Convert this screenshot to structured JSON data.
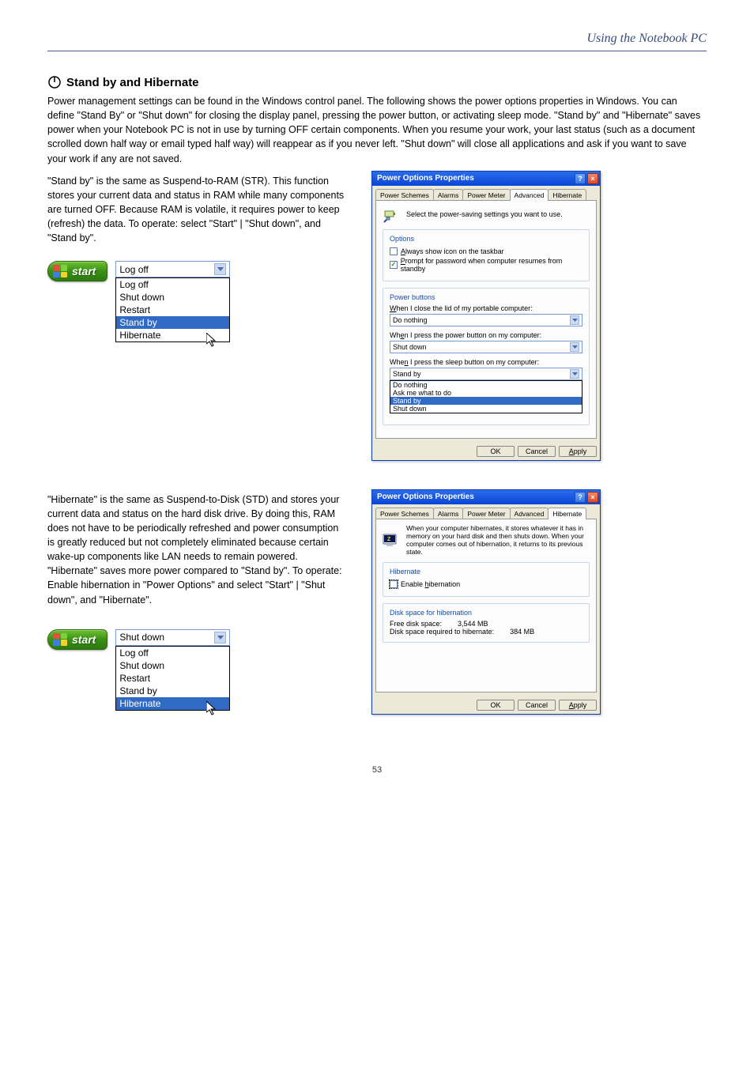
{
  "header": {
    "title": "Using the Notebook PC"
  },
  "section1": {
    "title": "Stand by and Hibernate",
    "body1": "Power management settings can be found in the Windows control panel. The following shows the power options properties in Windows. You can define \"Stand By\" or \"Shut down\" for closing the display panel, pressing the power button, or activating sleep mode. \"Stand by\" and \"Hibernate\" saves power when your Notebook PC is not in use by turning OFF certain components. When you resume your work, your last status (such as a document scrolled down half way or email typed half way) will reappear as if you never left. \"Shut down\" will close all applications and ask if you want to save your work if any are not saved.",
    "body2": "\"Stand by\" is the same as Suspend-to-RAM (STR). This function stores your current data and status in RAM while many components are turned OFF. Because RAM is volatile, it requires power to keep (refresh) the data. To operate: select \"Start\" | \"Shut down\", and \"Stand by\".",
    "body3": "\"Hibernate\" is the same as Suspend-to-Disk (STD) and stores your current data and status on the hard disk drive. By doing this, RAM does not have to be periodically refreshed and power consumption is greatly reduced but not completely eliminated because certain wake-up components like LAN needs to remain powered. \"Hibernate\" saves more power compared to \"Stand by\". To operate: Enable hibernation in \"Power Options\" and select \"Start\" | \"Shut down\", and \"Hibernate\"."
  },
  "startButton": {
    "label": "start"
  },
  "standbyMenu": {
    "selected": "Log off",
    "items": [
      "Log off",
      "Shut down",
      "Restart",
      "Stand by",
      "Hibernate"
    ],
    "highlighted": "Stand by"
  },
  "hibernateMenu": {
    "selected": "Shut down",
    "items": [
      "Log off",
      "Shut down",
      "Restart",
      "Stand by",
      "Hibernate"
    ],
    "highlighted": "Hibernate"
  },
  "advDialog": {
    "title": "Power Options Properties",
    "tabs": [
      "Power Schemes",
      "Alarms",
      "Power Meter",
      "Advanced",
      "Hibernate"
    ],
    "activeTab": "Advanced",
    "intro": "Select the power-saving settings you want to use.",
    "optionsLegend": "Options",
    "chkShowIcon": {
      "checked": false,
      "label": "Always show icon on the taskbar"
    },
    "chkPrompt": {
      "checked": true,
      "label": "Prompt for password when computer resumes from standby"
    },
    "powerButtonsLegend": "Power buttons",
    "lidLabel": "When I close the lid of my portable computer:",
    "lidValue": "Do nothing",
    "powerLabel": "When I press the power button on my computer:",
    "powerValue": "Shut down",
    "sleepLabel": "When I press the sleep button on my computer:",
    "sleepValue": "Stand by",
    "sleepOptions": [
      "Do nothing",
      "Ask me what to do",
      "Stand by",
      "Shut down"
    ],
    "sleepHighlighted": "Stand by",
    "buttons": {
      "ok": "OK",
      "cancel": "Cancel",
      "apply": "Apply"
    }
  },
  "hibDialog": {
    "title": "Power Options Properties",
    "tabs": [
      "Power Schemes",
      "Alarms",
      "Power Meter",
      "Advanced",
      "Hibernate"
    ],
    "activeTab": "Hibernate",
    "intro": "When your computer hibernates, it stores whatever it has in memory on your hard disk and then shuts down. When your computer comes out of hibernation, it returns to its previous state.",
    "hibLegend": "Hibernate",
    "chkEnable": {
      "checked": false,
      "label": "Enable hibernation"
    },
    "diskLegend": "Disk space for hibernation",
    "freeLabel": "Free disk space:",
    "freeValue": "3,544 MB",
    "reqLabel": "Disk space required to hibernate:",
    "reqValue": "384 MB",
    "buttons": {
      "ok": "OK",
      "cancel": "Cancel",
      "apply": "Apply"
    }
  },
  "pageNumber": "53"
}
